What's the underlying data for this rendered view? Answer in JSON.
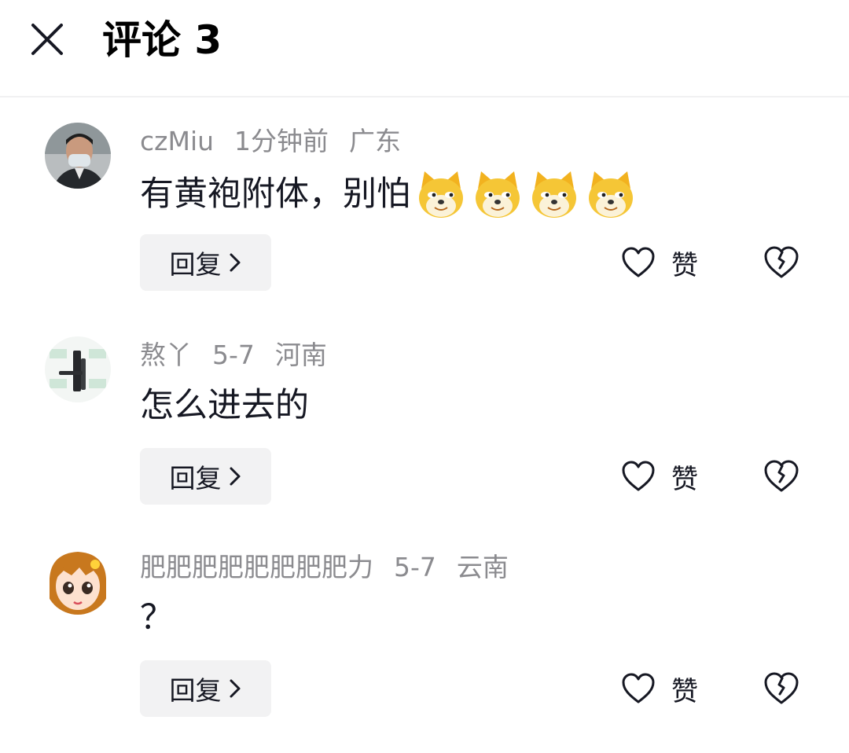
{
  "header": {
    "title": "评论 3",
    "close_icon": "close-icon"
  },
  "comments": [
    {
      "username": "czMiu",
      "time": "1分钟前",
      "location": "广东",
      "text": "有黄袍附体，别怕",
      "emoji": "doge-emoji",
      "emoji_count": 4,
      "reply_label": "回复",
      "like_label": "赞"
    },
    {
      "username": "熬丫",
      "time": "5-7",
      "location": "河南",
      "text": "怎么进去的",
      "reply_label": "回复",
      "like_label": "赞"
    },
    {
      "username": "肥肥肥肥肥肥肥肥力",
      "time": "5-7",
      "location": "云南",
      "text": "？",
      "reply_label": "回复",
      "like_label": "赞"
    }
  ],
  "colors": {
    "meta_text": "#8b8b8f",
    "main_text": "#161823",
    "reply_bg": "#f2f2f3",
    "divider": "#f1f1f2"
  }
}
